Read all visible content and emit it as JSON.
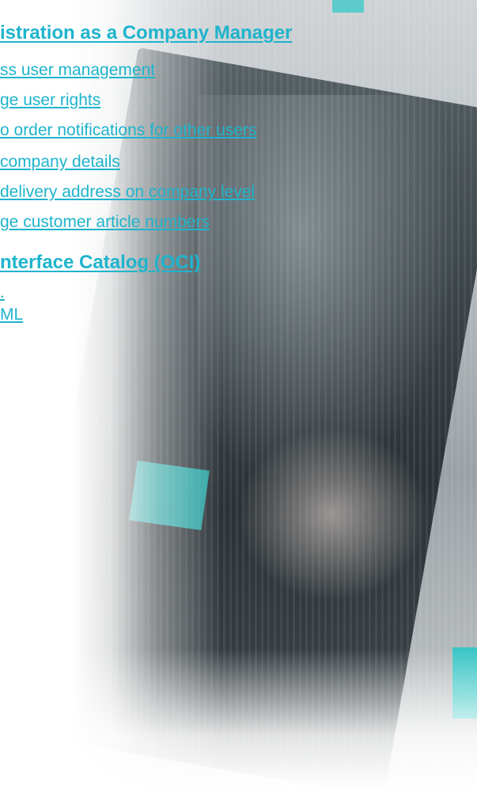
{
  "section_company_manager": {
    "heading": "istration as a Company Manager",
    "links": [
      "ss user management",
      "ge user rights",
      "o order notifications for other users",
      "company details",
      "delivery address on company level",
      "ge customer article numbers"
    ]
  },
  "section_oci": {
    "heading": "nterface Catalog (OCI)",
    "links": [
      ".",
      "ML"
    ]
  },
  "colors": {
    "link": "#1eb4cc",
    "accent_teal": "#2ec7c6"
  }
}
